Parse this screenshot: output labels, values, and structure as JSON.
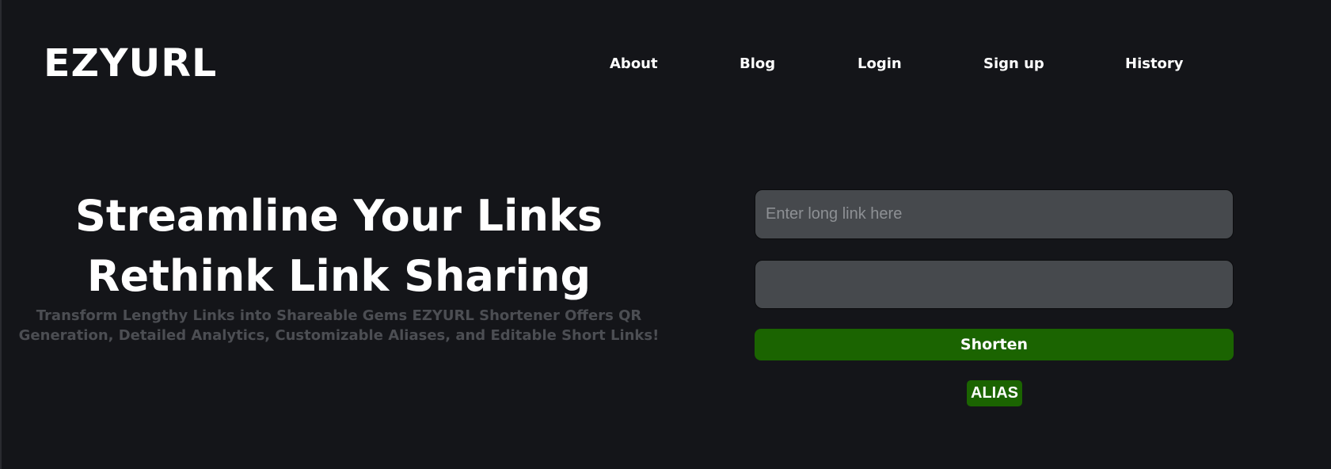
{
  "header": {
    "logo": "EZYURL",
    "nav": [
      "About",
      "Blog",
      "Login",
      "Sign up",
      "History"
    ]
  },
  "hero": {
    "title_line1": "Streamline Your Links",
    "title_line2": "Rethink Link Sharing",
    "subtitle": "Transform Lengthy Links into Shareable Gems EZYURL Shortener Offers QR Generation, Detailed Analytics, Customizable Aliases, and Editable Short Links!"
  },
  "form": {
    "long_link_placeholder": "Enter long link here",
    "long_link_value": "",
    "alias_value": "",
    "shorten_label": "Shorten",
    "alias_label": "ALIAS"
  },
  "colors": {
    "background": "#141519",
    "input_bg": "#46494d",
    "accent_green": "#1b6401",
    "subtitle_text": "#4c4e53"
  }
}
